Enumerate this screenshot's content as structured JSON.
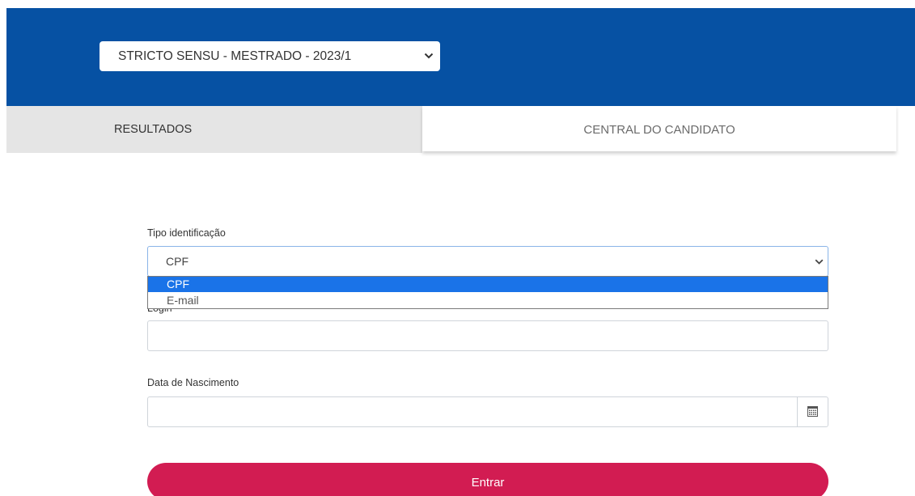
{
  "header": {
    "program_select": {
      "value": "STRICTO SENSU - MESTRADO - 2023/1",
      "icon": "chevron-down-icon"
    },
    "background_color": "#0651a3"
  },
  "tabs": [
    {
      "label": "RESULTADOS",
      "active": false
    },
    {
      "label": "CENTRAL DO CANDIDATO",
      "active": true
    }
  ],
  "form": {
    "tipo_identificacao": {
      "label": "Tipo identificação",
      "value": "CPF",
      "options": [
        "CPF",
        "E-mail"
      ],
      "highlighted_option": "CPF",
      "dropdown_open": true
    },
    "login": {
      "label": "Login",
      "value": ""
    },
    "data_nascimento": {
      "label": "Data de Nascimento",
      "value": "",
      "icon": "calendar-icon"
    },
    "submit_label": "Entrar",
    "submit_color": "#d21c52"
  }
}
